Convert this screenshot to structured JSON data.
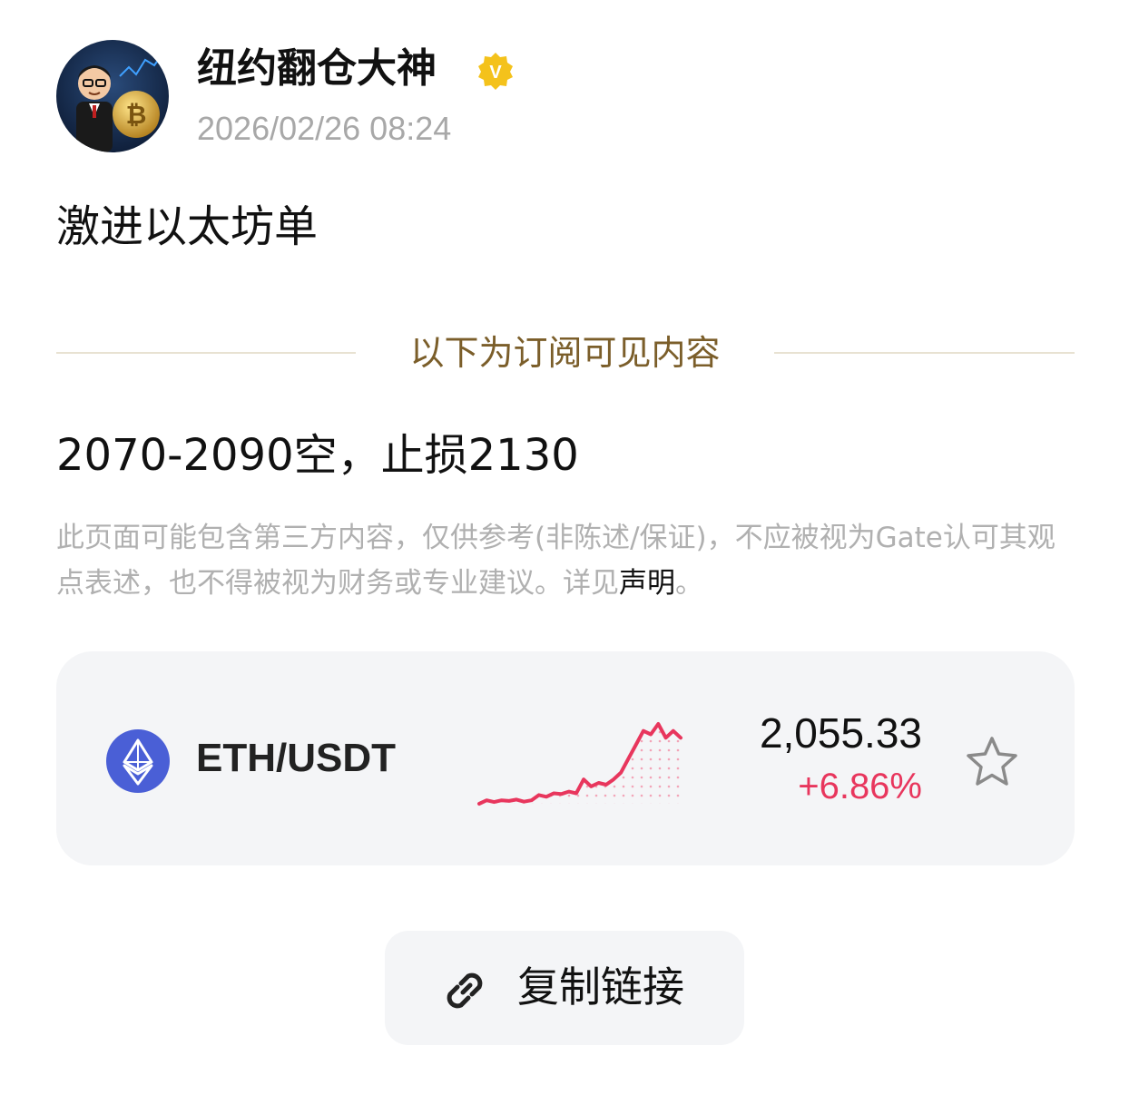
{
  "author": {
    "name": "纽约翻仓大神",
    "verified_badge": "V",
    "timestamp": "2026/02/26 08:24",
    "avatar_icon": "avatar-cartoon-trader-icon"
  },
  "post": {
    "text": "激进以太坊单",
    "subscription_divider": "以下为订阅可见内容",
    "signal": "2070-2090空，止损2130"
  },
  "disclaimer": {
    "text": "此页面可能包含第三方内容，仅供参考(非陈述/保证)，不应被视为Gate认可其观点表述，也不得被视为财务或专业建议。详见",
    "link_label": "声明",
    "suffix": "。"
  },
  "market": {
    "pair": "ETH/USDT",
    "price": "2,055.33",
    "change": "+6.86%",
    "trend_color": "#e8365d",
    "coin_icon": "ethereum-icon",
    "favorite_icon": "star-outline-icon",
    "sparkline": [
      3,
      4,
      3.5,
      4,
      3.8,
      4.2,
      3.6,
      4,
      5.5,
      5,
      6,
      5.8,
      6.5,
      6,
      10,
      8,
      9,
      8.5,
      10,
      12,
      16,
      20,
      24,
      23,
      26,
      22,
      24,
      22
    ]
  },
  "actions": {
    "copy_link_label": "复制链接",
    "copy_link_icon": "link-icon"
  }
}
